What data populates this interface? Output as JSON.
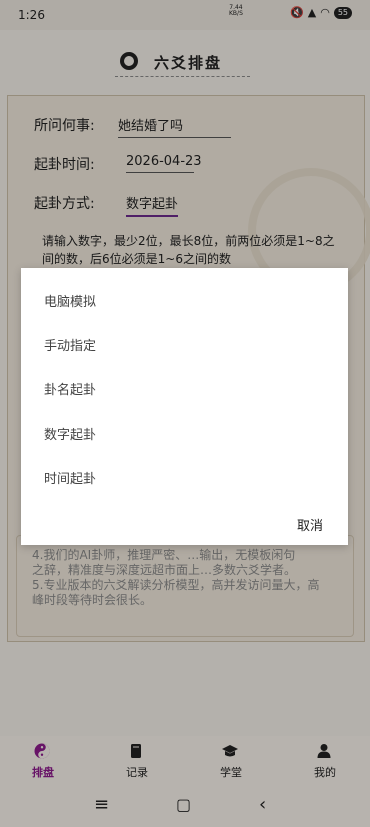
{
  "status": {
    "time": "1:26",
    "net_speed_top": "7.44",
    "net_speed_bottom": "KB/S",
    "battery": "55"
  },
  "header": {
    "title": "六爻排盘"
  },
  "form": {
    "question_label": "所问何事:",
    "question_value": "她结婚了吗",
    "time_label": "起卦时间:",
    "time_value": "2026-04-23",
    "method_label": "起卦方式:",
    "method_value": "数字起卦",
    "hint": "请输入数字，最少2位，最长8位，前两位必须是1~8之间的数，后6位必须是1~6之间的数"
  },
  "notes": [
    "4.我们的AI卦师，推理严密、…输出，无模板闲句",
    "之辞，精准度与深度远超市面上…多数六爻学者。",
    "5.专业版本的六爻解读分析模型，高并发访问量大，高",
    "峰时段等待时会很长。"
  ],
  "dialog": {
    "options": [
      "电脑模拟",
      "手动指定",
      "卦名起卦",
      "数字起卦",
      "时间起卦"
    ],
    "cancel": "取消"
  },
  "watermark": "top",
  "tabs": [
    {
      "label": "排盘",
      "icon": "yinyang-icon",
      "active": true
    },
    {
      "label": "记录",
      "icon": "book-icon",
      "active": false
    },
    {
      "label": "学堂",
      "icon": "graduation-cap-icon",
      "active": false
    },
    {
      "label": "我的",
      "icon": "person-icon",
      "active": false
    }
  ],
  "colors": {
    "accent": "#8a1a8a",
    "method_underline": "#6a2a8a"
  }
}
